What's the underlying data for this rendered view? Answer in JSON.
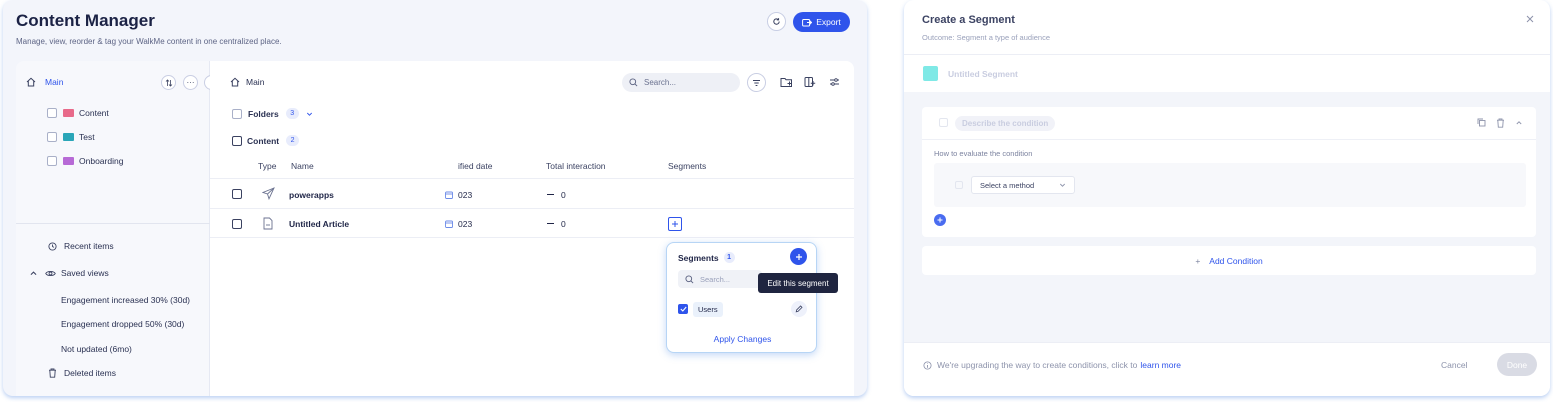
{
  "content_manager": {
    "title": "Content Manager",
    "subtitle": "Manage, view, reorder & tag your WalkMe content in one centralized place.",
    "export_label": "Export",
    "icons": {
      "refresh": "refresh-icon",
      "export": "export-icon"
    }
  },
  "sidebar": {
    "main_label": "Main",
    "folders": [
      {
        "label": "Content",
        "color": "#e86a8a"
      },
      {
        "label": "Test",
        "color": "#2aa6b8"
      },
      {
        "label": "Onboarding",
        "color": "#b76ad6"
      }
    ],
    "recent_items": "Recent items",
    "saved_views": "Saved views",
    "views": [
      "Engagement increased 30% (30d)",
      "Engagement dropped 50% (30d)",
      "Not updated (6mo)"
    ],
    "deleted_items": "Deleted items"
  },
  "main": {
    "breadcrumb": "Main",
    "search_placeholder": "Search...",
    "folders_label": "Folders",
    "folders_count": "3",
    "content_label": "Content",
    "content_count": "2",
    "columns": [
      "Type",
      "Name",
      "ified date",
      "Total interaction",
      "Segments"
    ],
    "rows": [
      {
        "name": "powerapps",
        "date": "023",
        "interaction": "0",
        "type_icon": "send-icon"
      },
      {
        "name": "Untitled Article",
        "date": "023",
        "interaction": "0",
        "type_icon": "article-icon"
      }
    ]
  },
  "segments_popup": {
    "title": "Segments",
    "count": "1",
    "search_placeholder": "Search...",
    "item": "Users",
    "tooltip": "Edit this segment",
    "apply": "Apply Changes"
  },
  "create_segment": {
    "title": "Create a Segment",
    "subtitle": "Outcome: Segment a type of audience",
    "name_placeholder": "Untitled Segment",
    "swatch_color": "#7fe9e6",
    "condition_placeholder": "Describe the condition",
    "evaluate_label": "How to evaluate the condition",
    "method_placeholder": "Select a method",
    "add_condition": "Add Condition",
    "notice": "We're upgrading the way to create conditions, click to",
    "learn_more": "learn more",
    "cancel": "Cancel",
    "done": "Done"
  },
  "colors": {
    "accent": "#2f54eb",
    "dark": "#1b2245"
  }
}
